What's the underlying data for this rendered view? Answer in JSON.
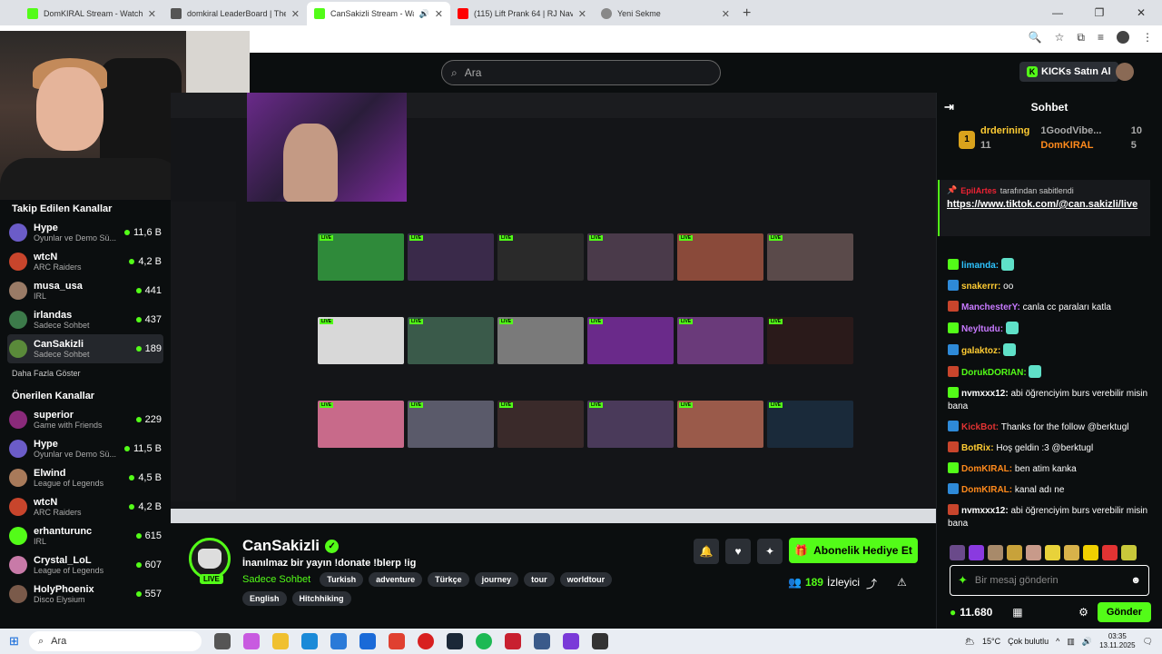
{
  "browser": {
    "tabs": [
      {
        "title": "DomKIRAL Stream - Watch Live",
        "fav": "#53fc18",
        "active": false
      },
      {
        "title": "domkiral LeaderBoard | The be",
        "fav": "#555555",
        "active": false
      },
      {
        "title": "CanSakizli Stream - Watch L",
        "fav": "#53fc18",
        "active": true
      },
      {
        "title": "(115) Lift Prank 64 | RJ Naved -",
        "fav": "#ff0000",
        "active": false
      },
      {
        "title": "Yeni Sekme",
        "fav": "#888888",
        "active": false
      }
    ],
    "new_tab": "+",
    "close": "✕"
  },
  "header": {
    "search_placeholder": "Ara",
    "kicks_button": "KICKs Satın Al"
  },
  "sidebar": {
    "followed_title": "Takip Edilen Kanallar",
    "followed": [
      {
        "name": "Hype",
        "category": "Oyunlar ve Demo Sü...",
        "viewers": "11,6 B",
        "color": "#6b5cc8"
      },
      {
        "name": "wtcN",
        "category": "ARC Raiders",
        "viewers": "4,2 B",
        "color": "#c8452c"
      },
      {
        "name": "musa_usa",
        "category": "IRL",
        "viewers": "441",
        "color": "#9a7b66"
      },
      {
        "name": "irlandas",
        "category": "Sadece Sohbet",
        "viewers": "437",
        "color": "#3c7a4a"
      },
      {
        "name": "CanSakizli",
        "category": "Sadece Sohbet",
        "viewers": "189",
        "color": "#5a8a3a"
      }
    ],
    "more_label": "Daha Fazla Göster",
    "recommended_title": "Önerilen Kanallar",
    "recommended": [
      {
        "name": "superior",
        "category": "Game with Friends",
        "viewers": "229",
        "color": "#8a2a7a"
      },
      {
        "name": "Hype",
        "category": "Oyunlar ve Demo Sü...",
        "viewers": "11,5 B",
        "color": "#6b5cc8"
      },
      {
        "name": "Elwind",
        "category": "League of Legends",
        "viewers": "4,5 B",
        "color": "#a87a5a"
      },
      {
        "name": "wtcN",
        "category": "ARC Raiders",
        "viewers": "4,2 B",
        "color": "#c8452c"
      },
      {
        "name": "erhanturunc",
        "category": "IRL",
        "viewers": "615",
        "color": "#53fc18"
      },
      {
        "name": "Crystal_LoL",
        "category": "League of Legends",
        "viewers": "607",
        "color": "#c87aa8"
      },
      {
        "name": "HolyPhoenix",
        "category": "Disco Elysium",
        "viewers": "557",
        "color": "#7a5a4a"
      }
    ]
  },
  "channel": {
    "live_badge": "LIVE",
    "name": "CanSakizli",
    "verified": "✓",
    "title": "İnanılmaz bir yayın !donate !blerp !ig",
    "category": "Sadece Sohbet",
    "tags": [
      "Turkish",
      "adventure",
      "Türkçe",
      "journey",
      "tour",
      "worldtour",
      "English",
      "Hitchhiking"
    ],
    "subscribe_label": "Abonelik Hediye Et",
    "viewer_count": "189",
    "viewer_label": "İzleyici"
  },
  "chat": {
    "title": "Sohbet",
    "gifters": {
      "top_name": "drderining",
      "top_count": "11",
      "second_name": "1GoodVibe...",
      "second_count": "10",
      "third_name": "DomKIRAL",
      "third_count": "5"
    },
    "pinned_user": "EpilArtes",
    "pinned_text": "tarafından sabitlendi",
    "pinned_link": "https://www.tiktok.com/@can.sakizli/live",
    "messages": [
      {
        "user": "limanda:",
        "color": "#2ec4ff",
        "text": ""
      },
      {
        "user": "snakerrr:",
        "color": "#ffcc33",
        "text": "oo"
      },
      {
        "user": "ManchesterY:",
        "color": "#c87aff",
        "text": "canla cc paraları katla"
      },
      {
        "user": "Neyltudu:",
        "color": "#c87aff",
        "text": ""
      },
      {
        "user": "galaktoz:",
        "color": "#ffcc33",
        "text": ""
      },
      {
        "user": "DorukDORIAN:",
        "color": "#53fc18",
        "text": ""
      },
      {
        "user": "nvmxxx12:",
        "color": "#ffffff",
        "text": "abi öğrenciyim burs verebilir misin bana"
      },
      {
        "user": "KickBot:",
        "color": "#e23333",
        "text": "Thanks for the follow @berktugl"
      },
      {
        "user": "BotRix:",
        "color": "#ffcc33",
        "text": "Hoş geldin :3 @berktugl"
      },
      {
        "user": "DomKIRAL:",
        "color": "#ff8a1c",
        "text": "ben atim kanka"
      },
      {
        "user": "DomKIRAL:",
        "color": "#ff8a1c",
        "text": "kanal adı ne"
      },
      {
        "user": "nvmxxx12:",
        "color": "#ffffff",
        "text": "abi öğrenciyim burs verebilir misin bana"
      }
    ],
    "input_placeholder": "Bir mesaj gönderin",
    "kicks_balance": "11.680",
    "send_label": "Gönder"
  },
  "taskbar": {
    "search_label": "Ara",
    "weather": "15°C",
    "weather_text": "Çok bulutlu",
    "time": "03:35",
    "date": "13.11.2025"
  },
  "colors": {
    "accent": "#53fc18",
    "background": "#0b0e0f",
    "panel": "#2b2f35"
  }
}
